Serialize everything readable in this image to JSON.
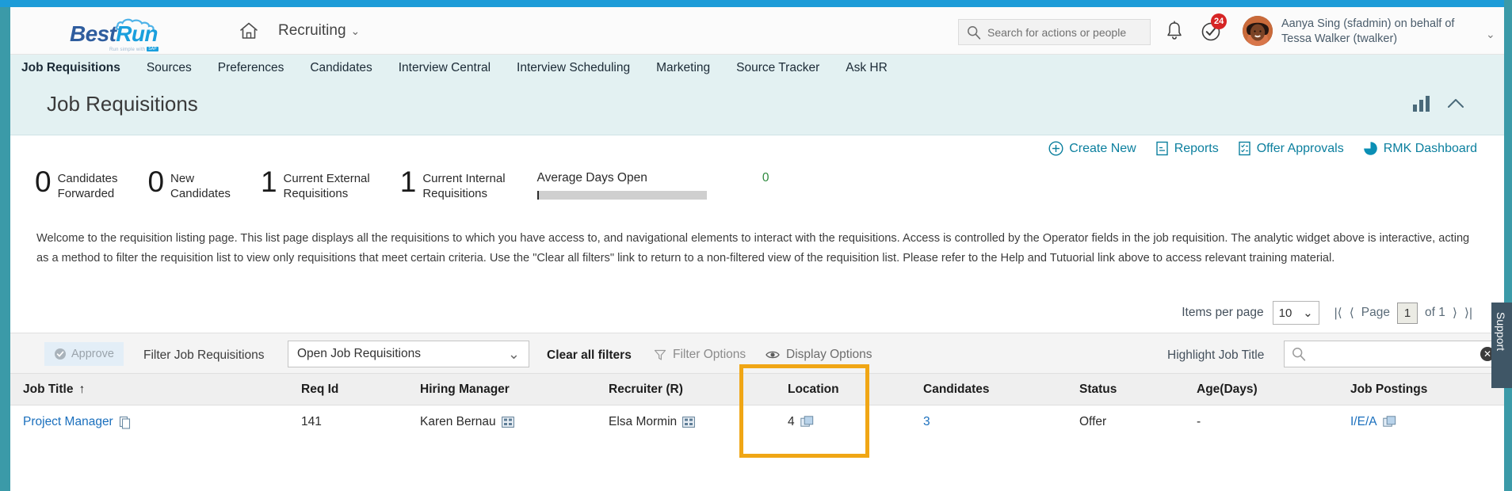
{
  "brand": {
    "logo_best": "Best",
    "logo_run": "Run",
    "tagline": "Run simple with",
    "tagline_mark": "SAP",
    "accent_blue": "#1d9cd8",
    "accent_teal": "#3b9aa8",
    "highlight_orange": "#f0a615"
  },
  "header": {
    "home_icon": "home-icon",
    "module_label": "Recruiting",
    "module_chevron": "⌄",
    "search": {
      "placeholder": "Search for actions or people",
      "value": "",
      "icon": "search-icon"
    },
    "notifications_icon": "bell-icon",
    "todo_icon": "check-circle-icon",
    "todo_count": "24",
    "avatar": "user-avatar",
    "user_text": "Aanya Sing (sfadmin) on behalf of Tessa Walker (twalker)",
    "user_chevron": "⌄"
  },
  "nav": {
    "tabs": [
      {
        "label": "Job Requisitions",
        "active": true
      },
      {
        "label": "Sources",
        "active": false
      },
      {
        "label": "Preferences",
        "active": false
      },
      {
        "label": "Candidates",
        "active": false
      },
      {
        "label": "Interview Central",
        "active": false
      },
      {
        "label": "Interview Scheduling",
        "active": false
      },
      {
        "label": "Marketing",
        "active": false
      },
      {
        "label": "Source Tracker",
        "active": false
      },
      {
        "label": "Ask HR",
        "active": false
      }
    ]
  },
  "page": {
    "title": "Job Requisitions",
    "chart_toggle_icon": "bar-chart-icon",
    "collapse_icon": "chevron-up-icon"
  },
  "actions": [
    {
      "label": "Create New",
      "icon": "plus-circle-icon"
    },
    {
      "label": "Reports",
      "icon": "document-icon"
    },
    {
      "label": "Offer Approvals",
      "icon": "approval-list-icon"
    },
    {
      "label": "RMK Dashboard",
      "icon": "pie-chart-icon"
    }
  ],
  "kpis": [
    {
      "value": "0",
      "label_line1": "Candidates",
      "label_line2": "Forwarded"
    },
    {
      "value": "0",
      "label_line1": "New",
      "label_line2": "Candidates"
    },
    {
      "value": "1",
      "label_line1": "Current External",
      "label_line2": "Requisitions"
    },
    {
      "value": "1",
      "label_line1": "Current Internal",
      "label_line2": "Requisitions"
    }
  ],
  "average_days_open": {
    "label": "Average Days Open",
    "value": "0",
    "bar_fill_percent": 0
  },
  "description": "Welcome to the requisition listing page. This list page displays all the requisitions to which you have access to, and navigational elements to interact with the requisitions. Access is controlled by the Operator fields in the job requisition. The analytic widget above is interactive, acting as a method to filter the requisition list to view only requisitions that meet certain criteria. Use the \"Clear all filters\" link to return to a non-filtered view of the requisition list. Please refer to the Help and Tutuorial link above to access relevant training material.",
  "pagination": {
    "items_per_page_label": "Items per page",
    "items_per_page_value": "10",
    "chevron": "⌄",
    "first_icon": "|⟨",
    "prev_icon": "⟨",
    "page_label": "Page",
    "page_value": "1",
    "of_label": "of 1",
    "next_icon": "⟩",
    "last_icon": "⟩|"
  },
  "toolbar": {
    "approve_label": "Approve",
    "approve_icon": "check-circle-icon",
    "filter_label": "Filter Job Requisitions",
    "filter_value": "Open Job Requisitions",
    "filter_chevron": "⌄",
    "clear_all_filters": "Clear all filters",
    "filter_options": "Filter Options",
    "filter_options_icon": "funnel-icon",
    "display_options": "Display Options",
    "display_options_icon": "eye-icon",
    "highlight_label": "Highlight Job Title",
    "highlight_value": "",
    "highlight_search_icon": "search-icon",
    "highlight_clear_icon": "clear-x-icon"
  },
  "table": {
    "columns": [
      "Job Title",
      "Req Id",
      "Hiring Manager",
      "Recruiter (R)",
      "Location",
      "Candidates",
      "Status",
      "Age(Days)",
      "Job Postings"
    ],
    "sort_column": "Job Title",
    "sort_arrow": "↑",
    "rows": [
      {
        "job_title": "Project Manager",
        "job_title_icon": "copy-icon",
        "req_id": "141",
        "hiring_manager": "Karen Bernau",
        "hiring_manager_icon": "org-chart-icon",
        "recruiter": "Elsa Mormin",
        "recruiter_icon": "org-chart-icon",
        "location": "4",
        "location_icon": "multi-window-icon",
        "candidates": "3",
        "status": "Offer",
        "age_days": "-",
        "job_postings": "I/E/A",
        "job_postings_icon": "multi-window-icon"
      }
    ]
  },
  "annotation": {
    "target": "location-column-highlight"
  },
  "support": {
    "label": "Support"
  }
}
